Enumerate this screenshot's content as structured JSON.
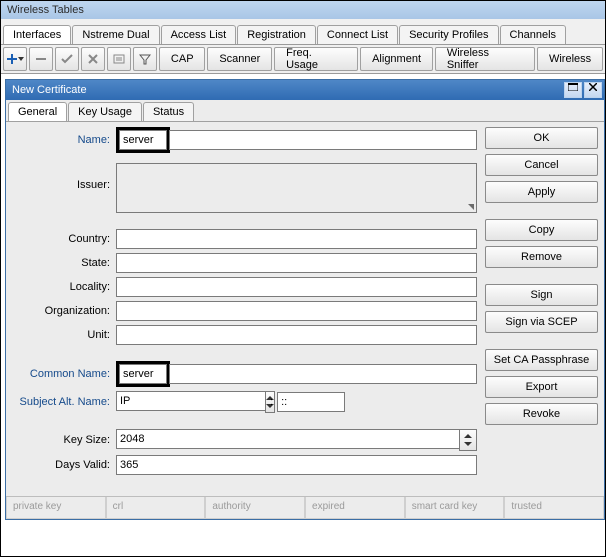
{
  "outer": {
    "title": "Wireless Tables"
  },
  "outer_tabs": [
    "Interfaces",
    "Nstreme Dual",
    "Access List",
    "Registration",
    "Connect List",
    "Security Profiles",
    "Channels"
  ],
  "outer_active_tab": 0,
  "toolbar": {
    "buttons": [
      "CAP",
      "Scanner",
      "Freq. Usage",
      "Alignment",
      "Wireless Sniffer",
      "Wireless"
    ]
  },
  "dialog": {
    "title": "New Certificate",
    "tabs": [
      "General",
      "Key Usage",
      "Status"
    ],
    "active_tab": 0,
    "buttons": [
      "OK",
      "Cancel",
      "Apply",
      "Copy",
      "Remove",
      "Sign",
      "Sign via SCEP",
      "Set CA Passphrase",
      "Export",
      "Revoke"
    ],
    "labels": {
      "name": "Name:",
      "issuer": "Issuer:",
      "country": "Country:",
      "state": "State:",
      "locality": "Locality:",
      "organization": "Organization:",
      "unit": "Unit:",
      "common_name": "Common Name:",
      "san": "Subject Alt. Name:",
      "key_size": "Key Size:",
      "days_valid": "Days Valid:"
    },
    "values": {
      "name": "server",
      "issuer": "",
      "country": "",
      "state": "",
      "locality": "",
      "organization": "",
      "unit": "",
      "common_name": "server",
      "san_type": "IP",
      "san_value": "::",
      "key_size": "2048",
      "days_valid": "365"
    },
    "status_cells": [
      "private key",
      "crl",
      "authority",
      "expired",
      "smart card key",
      "trusted"
    ]
  }
}
